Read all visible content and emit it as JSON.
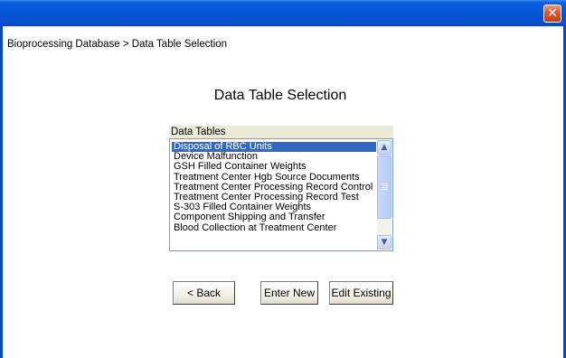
{
  "window": {
    "close_icon": "close-icon",
    "close_glyph": "✕"
  },
  "breadcrumb": "Bioprocessing Database > Data Table Selection",
  "page_title": "Data Table Selection",
  "list": {
    "header": "Data Tables",
    "items": [
      {
        "label": "Disposal of RBC Units",
        "selected": true
      },
      {
        "label": "Device Malfunction",
        "selected": false
      },
      {
        "label": "GSH Filled Container Weights",
        "selected": false
      },
      {
        "label": "Treatment Center Hgb Source Documents",
        "selected": false
      },
      {
        "label": "Treatment Center Processing Record Control",
        "selected": false
      },
      {
        "label": "Treatment Center Processing Record Test",
        "selected": false
      },
      {
        "label": "S-303 Filled Container Weights",
        "selected": false
      },
      {
        "label": "Component Shipping and Transfer",
        "selected": false
      },
      {
        "label": "Blood Collection at Treatment Center",
        "selected": false
      }
    ],
    "scroll_up_glyph": "▲",
    "scroll_down_glyph": "▼"
  },
  "buttons": {
    "back": "< Back",
    "enter_new": "Enter New",
    "edit_existing": "Edit Existing"
  },
  "colors": {
    "titlebar": "#0553d6",
    "selection": "#316ac5",
    "close_button": "#d8582e"
  }
}
